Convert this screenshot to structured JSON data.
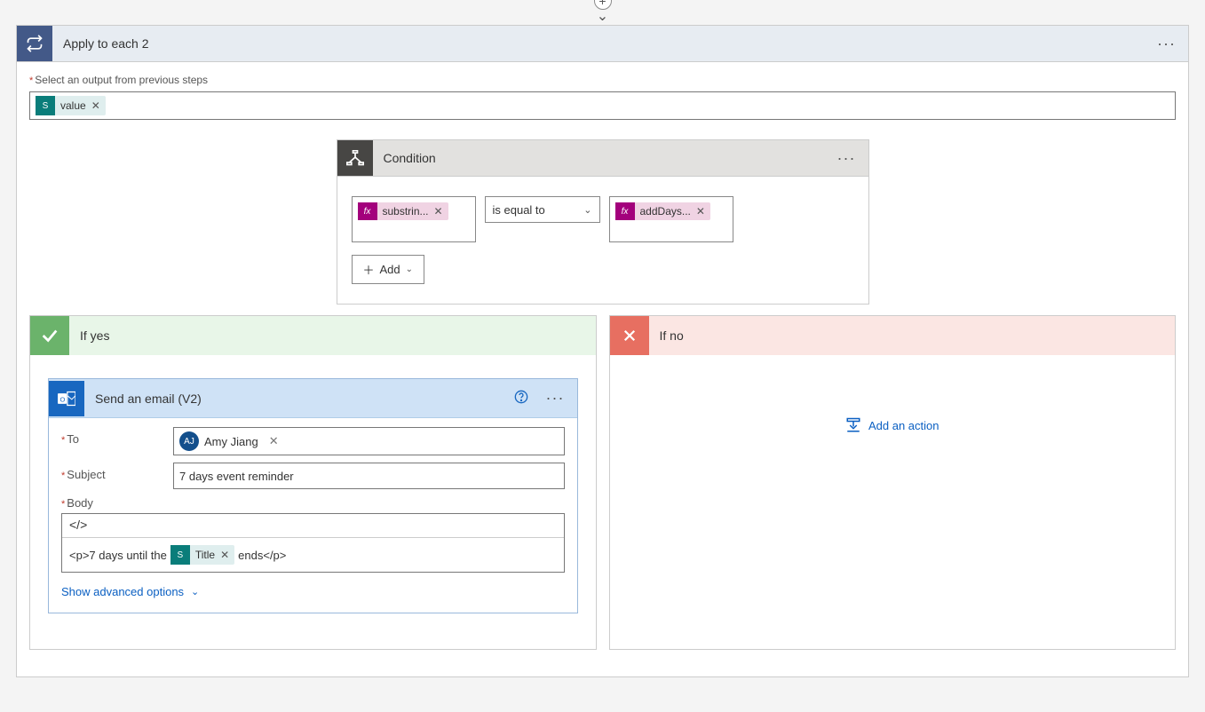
{
  "applyToEach": {
    "title": "Apply to each 2",
    "selectOutputLabel": "Select an output from previous steps",
    "outputToken": "value"
  },
  "condition": {
    "title": "Condition",
    "left": "substrin...",
    "operator": "is equal to",
    "right": "addDays...",
    "addLabel": "Add"
  },
  "yesBranch": {
    "title": "If yes",
    "email": {
      "title": "Send an email (V2)",
      "toLabel": "To",
      "toPersonInitials": "AJ",
      "toPersonName": "Amy Jiang",
      "subjectLabel": "Subject",
      "subjectValue": "7 days event reminder",
      "bodyLabel": "Body",
      "bodyCodeIcon": "</>",
      "bodyPrefix": "<p>7 days until the",
      "bodyToken": "Title",
      "bodySuffix": "ends</p>",
      "advancedLabel": "Show advanced options"
    }
  },
  "noBranch": {
    "title": "If no",
    "addActionLabel": "Add an action"
  }
}
